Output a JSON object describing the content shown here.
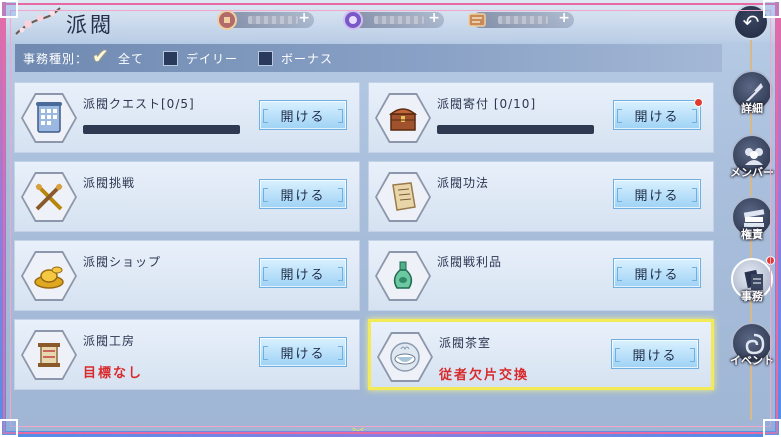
{
  "header": {
    "title": "派閥",
    "currencies": [
      {
        "icon": "coin-icon",
        "plus": "+"
      },
      {
        "icon": "gem-icon",
        "plus": "+"
      },
      {
        "icon": "scroll-ticket-icon",
        "plus": "+"
      }
    ]
  },
  "filter": {
    "label": "事務種別：",
    "options": [
      {
        "label": "全て",
        "checked": true
      },
      {
        "label": "デイリー",
        "checked": false
      },
      {
        "label": "ボーナス",
        "checked": false
      }
    ]
  },
  "cards": [
    {
      "title": "派閥クエスト[0/5]",
      "icon": "calendar-scroll-icon",
      "button": "開ける",
      "progress": 0.0,
      "red_dot": false
    },
    {
      "title": "派閥寄付 [0/10]",
      "icon": "treasure-chest-icon",
      "button": "開ける",
      "progress": 0.0,
      "red_dot": true
    },
    {
      "title": "派閥挑戦",
      "icon": "crossed-swords-icon",
      "button": "開ける",
      "red_dot": false
    },
    {
      "title": "派閥功法",
      "icon": "manual-scroll-icon",
      "button": "開ける",
      "red_dot": false
    },
    {
      "title": "派閥ショップ",
      "icon": "gold-ingot-icon",
      "button": "開ける",
      "red_dot": false
    },
    {
      "title": "派閥戦利品",
      "icon": "jade-vase-icon",
      "button": "開ける",
      "red_dot": false
    },
    {
      "title": "派閥工房",
      "icon": "spool-icon",
      "subtitle": "目標なし",
      "button": "開ける",
      "red_dot": false
    },
    {
      "title": "派閥茶室",
      "icon": "teacup-icon",
      "subtitle": "従者欠片交換",
      "button": "開ける",
      "red_dot": false,
      "highlighted": true
    }
  ],
  "sidebar": {
    "back": "↶",
    "items": [
      {
        "label": "詳細",
        "icon": "feather-pen-icon",
        "active": false,
        "red_dot": false
      },
      {
        "label": "メンバー",
        "icon": "members-icon",
        "active": false,
        "red_dot": false
      },
      {
        "label": "権責",
        "icon": "books-icon",
        "active": false,
        "red_dot": false
      },
      {
        "label": "事務",
        "icon": "documents-icon",
        "active": true,
        "red_dot": true
      },
      {
        "label": "イベント",
        "icon": "event-swirl-icon",
        "active": false,
        "red_dot": false
      }
    ]
  },
  "colors": {
    "accent_red": "#d82a2a",
    "button_blue": "#9fd2f5",
    "highlight_yellow": "#f2ea57",
    "frame_pink": "#e86aa4"
  }
}
